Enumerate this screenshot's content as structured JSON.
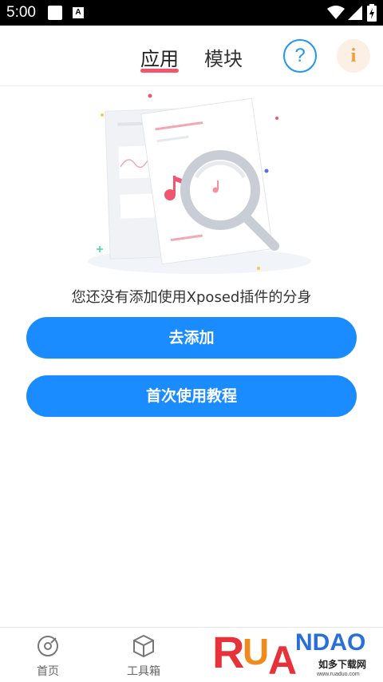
{
  "status_bar": {
    "time": "5:00",
    "notification_letter": "A"
  },
  "top_tabs": [
    {
      "label": "应用",
      "active": true
    },
    {
      "label": "模块",
      "active": false
    }
  ],
  "help_button": {
    "glyph": "?"
  },
  "info_button": {
    "glyph": "i"
  },
  "empty_state": {
    "message": "您还没有添加使用Xposed插件的分身"
  },
  "buttons": {
    "add": "去添加",
    "tutorial": "首次使用教程"
  },
  "bottom_nav": [
    {
      "label": "首页",
      "icon": "disc-icon"
    },
    {
      "label": "工具箱",
      "icon": "box-icon"
    }
  ],
  "watermark": {
    "brand": "RUANDAO",
    "tagline": "如多下载网",
    "url": "www.ruaduo.com"
  },
  "colors": {
    "accent": "#1a8cff",
    "tab_underline": "#f0566d",
    "help": "#2196f3",
    "info": "#f29a3a"
  }
}
